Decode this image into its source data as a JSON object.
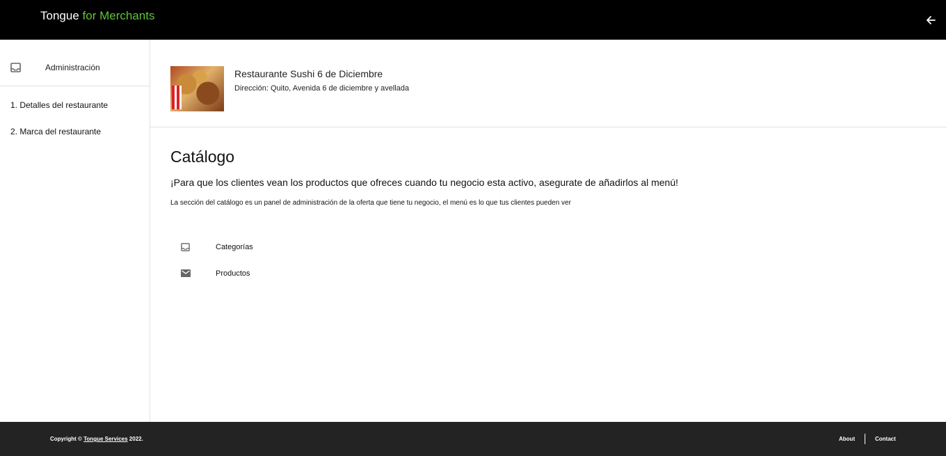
{
  "header": {
    "brand_main": "Tongue",
    "brand_accent": "for Merchants",
    "accent_color": "#5fc33a",
    "back_icon": "arrow-left-icon"
  },
  "sidebar": {
    "header_label": "Administración",
    "header_icon": "inbox-icon",
    "items": [
      {
        "label": "1. Detalles del restaurante"
      },
      {
        "label": "2. Marca del restaurante"
      }
    ]
  },
  "restaurant": {
    "name": "Restaurante Sushi 6 de Diciembre",
    "address": "Dirección: Quito, Avenida 6 de diciembre y avellada"
  },
  "catalog": {
    "title": "Catálogo",
    "lead": "¡Para que los clientes vean los productos que ofreces cuando tu negocio esta activo, asegurate de añadirlos al menú!",
    "description": "La sección del catálogo es un panel de administración de la oferta que tiene tu negocio, el menú es lo que tus clientes pueden ver",
    "items": [
      {
        "label": "Categorías",
        "icon": "inbox-icon"
      },
      {
        "label": "Productos",
        "icon": "mail-icon"
      }
    ]
  },
  "footer": {
    "copyright_prefix": "Copyright ©",
    "copyright_link": "Tongue Services",
    "copyright_suffix": "2022.",
    "about": "About",
    "contact": "Contact"
  }
}
